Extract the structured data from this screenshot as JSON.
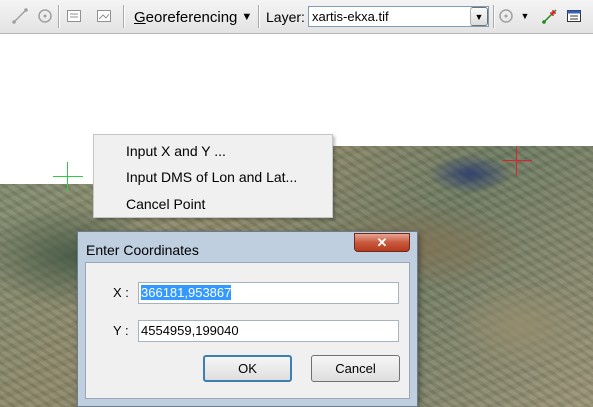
{
  "toolbar": {
    "menu_label_first": "G",
    "menu_label_rest": "eoreferencing",
    "layer_label": "Layer:",
    "layer_value": "xartis-ekxa.tif",
    "icons": [
      "add-control-point-icon",
      "rotate-icon",
      "link-table-icon",
      "image-icon",
      "rotate-dropdown-icon",
      "add-control-points-icon",
      "view-link-table-icon"
    ]
  },
  "context_menu": {
    "items": [
      {
        "label": "Input X and Y ..."
      },
      {
        "label": "Input DMS of Lon and Lat..."
      },
      {
        "label": "Cancel Point"
      }
    ]
  },
  "dialog": {
    "title": "Enter Coordinates",
    "x_label": "X :",
    "x_value": "366181,953867",
    "y_label": "Y :",
    "y_value": "4554959,199040",
    "ok_label": "OK",
    "cancel_label": "Cancel"
  },
  "colors": {
    "accent_selection": "#3399ff",
    "close_button": "#c85a3e",
    "marker_green": "#2ecc40",
    "marker_red": "#e0202a"
  }
}
